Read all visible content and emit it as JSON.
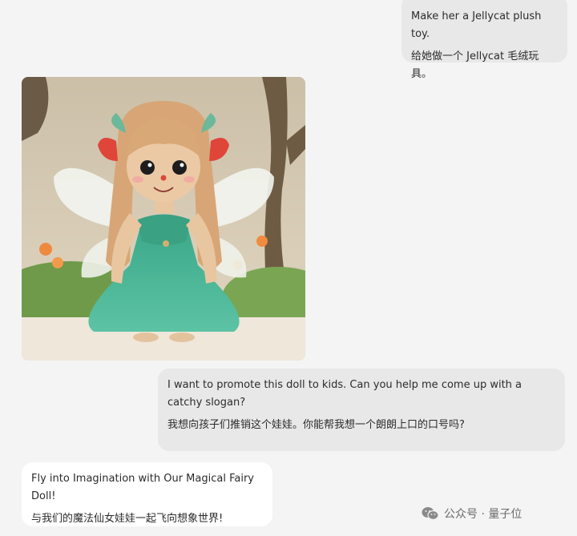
{
  "messages": [
    {
      "role": "user",
      "lines": [
        "Make her a Jellycat plush toy.",
        "给她做一个 Jellycat 毛绒玩具。"
      ]
    },
    {
      "role": "assistant",
      "image": {
        "icon": "fairy-doll-plush-image"
      }
    },
    {
      "role": "user",
      "lines": [
        "I want to promote this doll to kids. Can you help me come up with a catchy slogan?",
        "我想向孩子们推销这个娃娃。你能帮我想一个朗朗上口的口号吗?"
      ]
    },
    {
      "role": "assistant",
      "lines": [
        "Fly into Imagination with Our Magical Fairy Doll!",
        "与我们的魔法仙女娃娃一起飞向想象世界!"
      ]
    }
  ],
  "watermark": {
    "text": "公众号 · 量子位",
    "icon": "wechat-icon"
  },
  "colors": {
    "background": "#f4f4f4",
    "user_bubble": "#e8e8e8",
    "assistant_bubble": "#ffffff",
    "dress": "#4fb79a"
  }
}
